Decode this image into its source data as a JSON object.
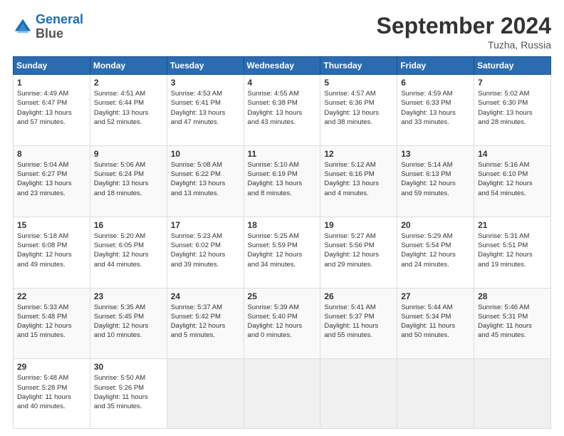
{
  "header": {
    "logo_line1": "General",
    "logo_line2": "Blue",
    "month": "September 2024",
    "location": "Tuzha, Russia"
  },
  "weekdays": [
    "Sunday",
    "Monday",
    "Tuesday",
    "Wednesday",
    "Thursday",
    "Friday",
    "Saturday"
  ],
  "rows": [
    [
      {
        "day": "1",
        "info": "Sunrise: 4:49 AM\nSunset: 6:47 PM\nDaylight: 13 hours\nand 57 minutes."
      },
      {
        "day": "2",
        "info": "Sunrise: 4:51 AM\nSunset: 6:44 PM\nDaylight: 13 hours\nand 52 minutes."
      },
      {
        "day": "3",
        "info": "Sunrise: 4:53 AM\nSunset: 6:41 PM\nDaylight: 13 hours\nand 47 minutes."
      },
      {
        "day": "4",
        "info": "Sunrise: 4:55 AM\nSunset: 6:38 PM\nDaylight: 13 hours\nand 43 minutes."
      },
      {
        "day": "5",
        "info": "Sunrise: 4:57 AM\nSunset: 6:36 PM\nDaylight: 13 hours\nand 38 minutes."
      },
      {
        "day": "6",
        "info": "Sunrise: 4:59 AM\nSunset: 6:33 PM\nDaylight: 13 hours\nand 33 minutes."
      },
      {
        "day": "7",
        "info": "Sunrise: 5:02 AM\nSunset: 6:30 PM\nDaylight: 13 hours\nand 28 minutes."
      }
    ],
    [
      {
        "day": "8",
        "info": "Sunrise: 5:04 AM\nSunset: 6:27 PM\nDaylight: 13 hours\nand 23 minutes."
      },
      {
        "day": "9",
        "info": "Sunrise: 5:06 AM\nSunset: 6:24 PM\nDaylight: 13 hours\nand 18 minutes."
      },
      {
        "day": "10",
        "info": "Sunrise: 5:08 AM\nSunset: 6:22 PM\nDaylight: 13 hours\nand 13 minutes."
      },
      {
        "day": "11",
        "info": "Sunrise: 5:10 AM\nSunset: 6:19 PM\nDaylight: 13 hours\nand 8 minutes."
      },
      {
        "day": "12",
        "info": "Sunrise: 5:12 AM\nSunset: 6:16 PM\nDaylight: 13 hours\nand 4 minutes."
      },
      {
        "day": "13",
        "info": "Sunrise: 5:14 AM\nSunset: 6:13 PM\nDaylight: 12 hours\nand 59 minutes."
      },
      {
        "day": "14",
        "info": "Sunrise: 5:16 AM\nSunset: 6:10 PM\nDaylight: 12 hours\nand 54 minutes."
      }
    ],
    [
      {
        "day": "15",
        "info": "Sunrise: 5:18 AM\nSunset: 6:08 PM\nDaylight: 12 hours\nand 49 minutes."
      },
      {
        "day": "16",
        "info": "Sunrise: 5:20 AM\nSunset: 6:05 PM\nDaylight: 12 hours\nand 44 minutes."
      },
      {
        "day": "17",
        "info": "Sunrise: 5:23 AM\nSunset: 6:02 PM\nDaylight: 12 hours\nand 39 minutes."
      },
      {
        "day": "18",
        "info": "Sunrise: 5:25 AM\nSunset: 5:59 PM\nDaylight: 12 hours\nand 34 minutes."
      },
      {
        "day": "19",
        "info": "Sunrise: 5:27 AM\nSunset: 5:56 PM\nDaylight: 12 hours\nand 29 minutes."
      },
      {
        "day": "20",
        "info": "Sunrise: 5:29 AM\nSunset: 5:54 PM\nDaylight: 12 hours\nand 24 minutes."
      },
      {
        "day": "21",
        "info": "Sunrise: 5:31 AM\nSunset: 5:51 PM\nDaylight: 12 hours\nand 19 minutes."
      }
    ],
    [
      {
        "day": "22",
        "info": "Sunrise: 5:33 AM\nSunset: 5:48 PM\nDaylight: 12 hours\nand 15 minutes."
      },
      {
        "day": "23",
        "info": "Sunrise: 5:35 AM\nSunset: 5:45 PM\nDaylight: 12 hours\nand 10 minutes."
      },
      {
        "day": "24",
        "info": "Sunrise: 5:37 AM\nSunset: 5:42 PM\nDaylight: 12 hours\nand 5 minutes."
      },
      {
        "day": "25",
        "info": "Sunrise: 5:39 AM\nSunset: 5:40 PM\nDaylight: 12 hours\nand 0 minutes."
      },
      {
        "day": "26",
        "info": "Sunrise: 5:41 AM\nSunset: 5:37 PM\nDaylight: 11 hours\nand 55 minutes."
      },
      {
        "day": "27",
        "info": "Sunrise: 5:44 AM\nSunset: 5:34 PM\nDaylight: 11 hours\nand 50 minutes."
      },
      {
        "day": "28",
        "info": "Sunrise: 5:46 AM\nSunset: 5:31 PM\nDaylight: 11 hours\nand 45 minutes."
      }
    ],
    [
      {
        "day": "29",
        "info": "Sunrise: 5:48 AM\nSunset: 5:28 PM\nDaylight: 11 hours\nand 40 minutes."
      },
      {
        "day": "30",
        "info": "Sunrise: 5:50 AM\nSunset: 5:26 PM\nDaylight: 11 hours\nand 35 minutes."
      },
      {
        "day": "",
        "info": ""
      },
      {
        "day": "",
        "info": ""
      },
      {
        "day": "",
        "info": ""
      },
      {
        "day": "",
        "info": ""
      },
      {
        "day": "",
        "info": ""
      }
    ]
  ]
}
